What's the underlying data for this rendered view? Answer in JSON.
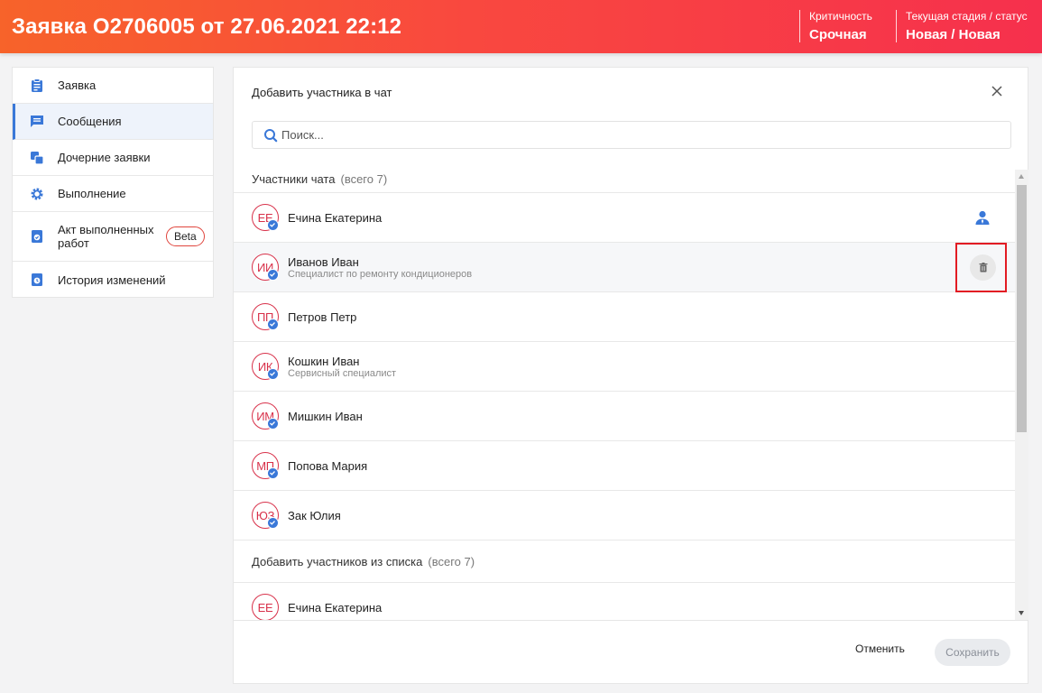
{
  "header": {
    "title": "Заявка O2706005 от 27.06.2021 22:12",
    "criticality_label": "Критичность",
    "criticality_value": "Срочная",
    "stage_label": "Текущая стадия / статус",
    "stage_value": "Новая / Новая"
  },
  "sidebar": {
    "items": [
      {
        "label": "Заявка",
        "icon": "clipboard-icon",
        "active": false
      },
      {
        "label": "Сообщения",
        "icon": "message-icon",
        "active": true
      },
      {
        "label": "Дочерние заявки",
        "icon": "child-requests-icon",
        "active": false
      },
      {
        "label": "Выполнение",
        "icon": "gear-icon",
        "active": false
      },
      {
        "label": "Акт выполненных работ",
        "icon": "act-icon",
        "active": false,
        "badge": "Beta"
      },
      {
        "label": "История изменений",
        "icon": "history-icon",
        "active": false
      }
    ]
  },
  "dialog": {
    "title": "Добавить участника в чат",
    "search_placeholder": "Поиск...",
    "participants_header": "Участники чата",
    "participants_count": "(всего 7)",
    "participants": [
      {
        "initials": "ЕЕ",
        "name": "Ечина Екатерина",
        "role": ""
      },
      {
        "initials": "ИИ",
        "name": "Иванов Иван",
        "role": "Специалист по ремонту кондиционеров"
      },
      {
        "initials": "ПП",
        "name": "Петров Петр",
        "role": ""
      },
      {
        "initials": "ИК",
        "name": "Кошкин Иван",
        "role": "Сервисный специалист"
      },
      {
        "initials": "ИМ",
        "name": "Мишкин Иван",
        "role": ""
      },
      {
        "initials": "МП",
        "name": "Попова Мария",
        "role": ""
      },
      {
        "initials": "ЮЗ",
        "name": "Зак Юлия",
        "role": ""
      }
    ],
    "add_header": "Добавить участников из списка",
    "add_count": "(всего 7)",
    "add_list": [
      {
        "initials": "ЕЕ",
        "name": "Ечина Екатерина"
      }
    ],
    "cancel_label": "Отменить",
    "save_label": "Сохранить"
  },
  "colors": {
    "header_gradient_start": "#f7632a",
    "header_gradient_end": "#f6304d",
    "accent_blue": "#3a78d8",
    "avatar_red": "#d8314a",
    "highlight_box": "#e21b23"
  }
}
